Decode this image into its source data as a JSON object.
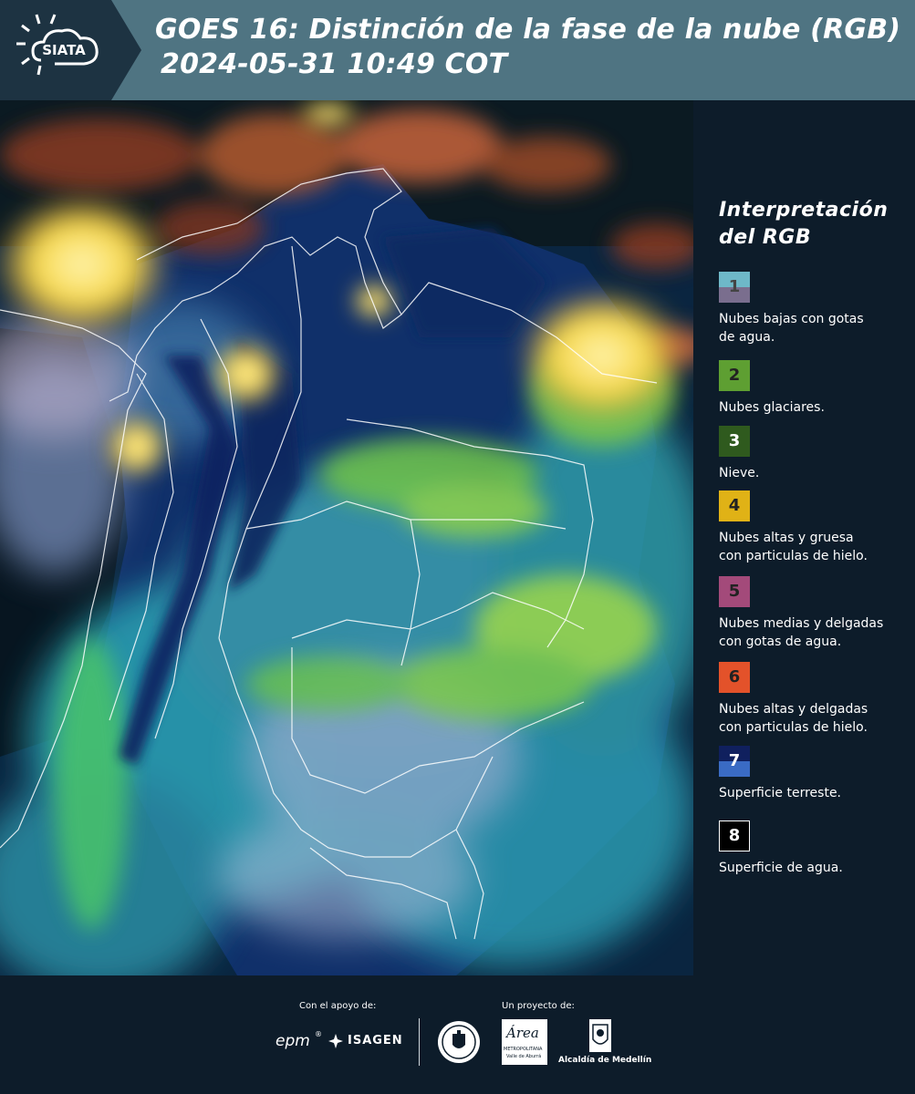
{
  "header": {
    "logo_text": "SIATA",
    "title_line1": "GOES 16: Distinción de la fase de la nube (RGB)",
    "title_line2": "2024-05-31 10:49 COT"
  },
  "legend": {
    "title_line1": "Interpretación",
    "title_line2": "del RGB",
    "items": [
      {
        "number": "1",
        "label_line1": "Nubes bajas con gotas",
        "label_line2": "de agua.",
        "color_top": "#6eb8c8",
        "color_bottom": "#7a6e8e"
      },
      {
        "number": "2",
        "label_line1": "Nubes glaciares.",
        "label_line2": "",
        "color_top": "#5e9f32",
        "color_bottom": "#5e9f32"
      },
      {
        "number": "3",
        "label_line1": "Nieve.",
        "label_line2": "",
        "color_top": "#2f5a1e",
        "color_bottom": "#2f5a1e"
      },
      {
        "number": "4",
        "label_line1": "Nubes altas y gruesa",
        "label_line2": "con particulas de hielo.",
        "color_top": "#e0b216",
        "color_bottom": "#e0b216"
      },
      {
        "number": "5",
        "label_line1": "Nubes medias y delgadas",
        "label_line2": "con gotas de agua.",
        "color_top": "#a34a7a",
        "color_bottom": "#a34a7a"
      },
      {
        "number": "6",
        "label_line1": "Nubes altas y delgadas",
        "label_line2": "con particulas de hielo.",
        "color_top": "#e3522a",
        "color_bottom": "#e3522a"
      },
      {
        "number": "7",
        "label_line1": "Superficie terreste.",
        "label_line2": "",
        "color_top": "#10205e",
        "color_bottom": "#3a6bc4"
      },
      {
        "number": "8",
        "label_line1": "Superficie de agua.",
        "label_line2": "",
        "color_top": "#000000",
        "color_bottom": "#000000"
      }
    ]
  },
  "footer": {
    "support_label": "Con el apoyo de:",
    "project_label": "Un proyecto de:",
    "brand_epm": "epm",
    "brand_isagen": "ISAGEN",
    "brand_area": "Área",
    "brand_area_sub": "METROPOLITANA",
    "brand_area_sub2": "Valle de Aburrá",
    "brand_alcaldia": "Alcaldía de Medellín"
  },
  "colors": {
    "header_bg": "#4f7482",
    "panel_bg": "#0d1c2a",
    "map_land": "#0f2d5c",
    "map_cloud_cyan": "#3fb6b4",
    "map_cloud_green": "#8fd24a",
    "map_cloud_yellow": "#f5d94a",
    "map_cloud_orange": "#c8643a"
  }
}
